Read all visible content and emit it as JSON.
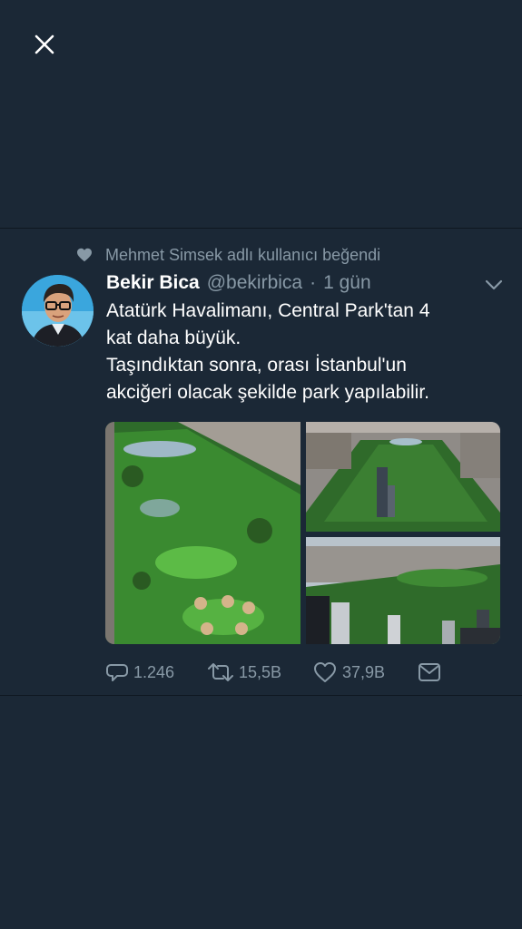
{
  "social_context": {
    "text": "Mehmet Simsek adlı kullanıcı beğendi",
    "icon": "heart-icon"
  },
  "tweet": {
    "author_name": "Bekir Bica",
    "author_handle": "@bekirbica",
    "separator": "·",
    "timestamp": "1 gün",
    "text_lines": [
      "Atatürk Havalimanı, Central Park'tan 4",
      "kat daha büyük.",
      "Taşındıktan sonra, orası İstanbul'un",
      "akciğeri olacak şekilde park yapılabilir."
    ]
  },
  "actions": {
    "reply_count": "1.246",
    "retweet_count": "15,5B",
    "like_count": "37,9B"
  },
  "colors": {
    "background": "#1b2836",
    "secondary_text": "#8899a6",
    "divider": "#0f1720"
  },
  "icons": [
    "close-icon",
    "heart-icon",
    "chevron-down-icon",
    "reply-icon",
    "retweet-icon",
    "like-icon",
    "direct-message-icon"
  ]
}
